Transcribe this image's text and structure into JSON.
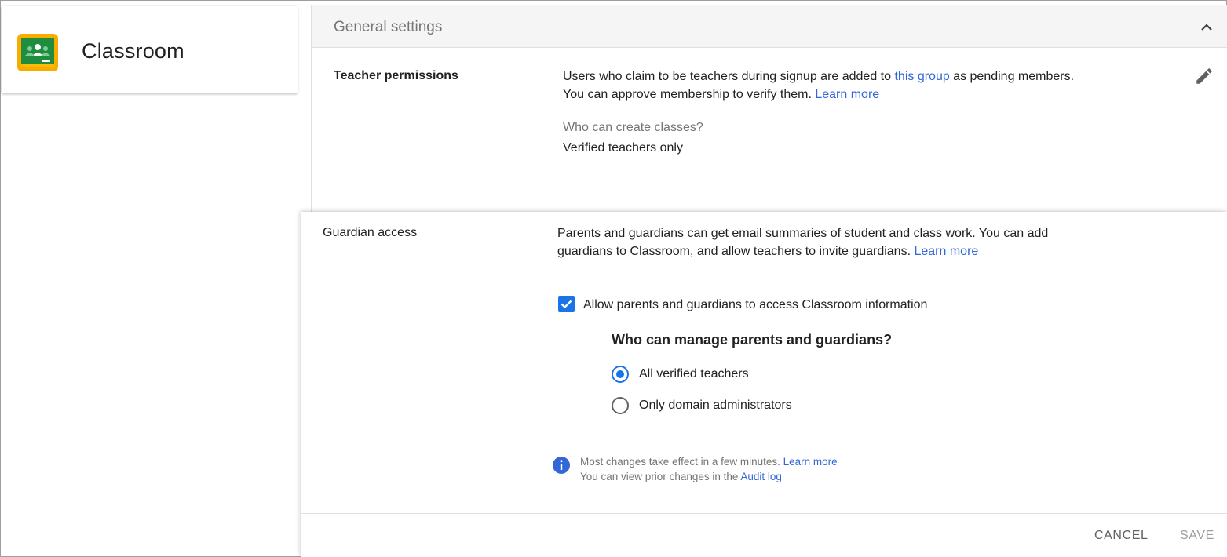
{
  "app": {
    "name": "Classroom",
    "icon": "google-classroom-icon"
  },
  "section": {
    "title": "General settings",
    "collapse_icon": "chevron-up-icon"
  },
  "teacher_permissions": {
    "label": "Teacher permissions",
    "line1_prefix": "Users who claim to be teachers during signup are added to ",
    "line1_link": "this group",
    "line1_suffix": " as pending members.",
    "line2_prefix": "You can approve membership to verify them. ",
    "line2_link": "Learn more",
    "question": "Who can create classes?",
    "value": "Verified teachers only",
    "edit_icon": "pencil-icon"
  },
  "guardian_access": {
    "label": "Guardian access",
    "desc_line1": "Parents and guardians can get email summaries of student and class work. You can add",
    "desc_line2_prefix": "guardians to Classroom, and allow teachers to invite guardians. ",
    "desc_link": "Learn more",
    "checkbox_label": "Allow parents and guardians to access Classroom information",
    "checkbox_checked": true,
    "manage_heading": "Who can manage parents and guardians?",
    "options": [
      {
        "label": "All verified teachers",
        "selected": true
      },
      {
        "label": "Only domain administrators",
        "selected": false
      }
    ]
  },
  "info": {
    "line1_prefix": "Most changes take effect in a few minutes. ",
    "line1_link": "Learn more",
    "line2_prefix": "You can view prior changes in the ",
    "line2_link": "Audit log"
  },
  "footer": {
    "cancel": "CANCEL",
    "save": "SAVE"
  },
  "colors": {
    "accent": "#1a73e8",
    "link": "#3367d6",
    "muted": "#757575",
    "disabled": "#9e9e9e"
  }
}
